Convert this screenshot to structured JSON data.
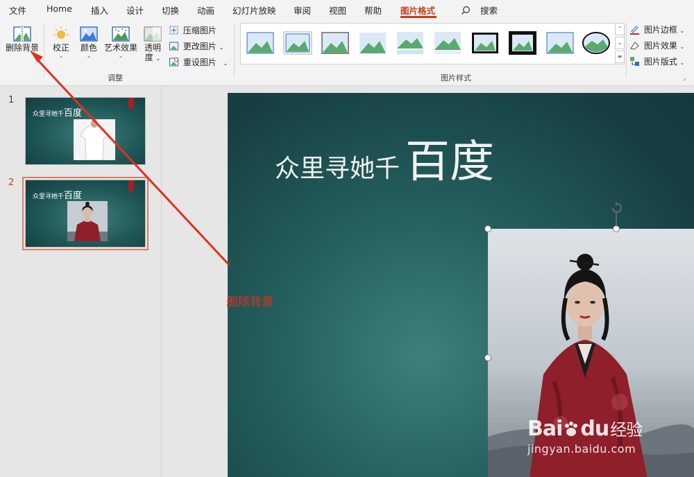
{
  "menu": {
    "tabs": [
      {
        "label": "文件"
      },
      {
        "label": "Home"
      },
      {
        "label": "插入"
      },
      {
        "label": "设计"
      },
      {
        "label": "切换"
      },
      {
        "label": "动画"
      },
      {
        "label": "幻灯片放映"
      },
      {
        "label": "审阅"
      },
      {
        "label": "视图"
      },
      {
        "label": "帮助"
      },
      {
        "label": "图片格式"
      }
    ],
    "active_tab": "图片格式",
    "search_label": "搜索"
  },
  "ribbon": {
    "remove_bg_label": "删除背景",
    "adjust_group": {
      "correct_label": "校正",
      "color_label": "颜色",
      "artistic_label": "艺术效果",
      "transparency_label_1": "透明",
      "transparency_label_2": "度",
      "compress_label": "压缩图片",
      "change_label": "更改图片",
      "reset_label": "重设图片",
      "group_label": "调整"
    },
    "styles_group": {
      "group_label": "图片样式",
      "border_label": "图片边框",
      "effects_label": "图片效果",
      "layout_label": "图片版式"
    }
  },
  "slides": [
    {
      "number": "1",
      "title_small": "众里寻她千",
      "title_large": "百度"
    },
    {
      "number": "2",
      "title_small": "众里寻她千",
      "title_large": "百度"
    }
  ],
  "main_slide": {
    "title_small": "众里寻她千",
    "title_large": "百度"
  },
  "annotation": {
    "text": "删除背景",
    "color": "#e0301e"
  },
  "watermark": {
    "brand": "Bai",
    "brand_mid": "du",
    "brand_cn": "经验",
    "url": "jingyan.baidu.com"
  },
  "colors": {
    "accent": "#c43e1c",
    "slide_bg": "#1f5757",
    "thumb_selection": "#e07a5f"
  }
}
